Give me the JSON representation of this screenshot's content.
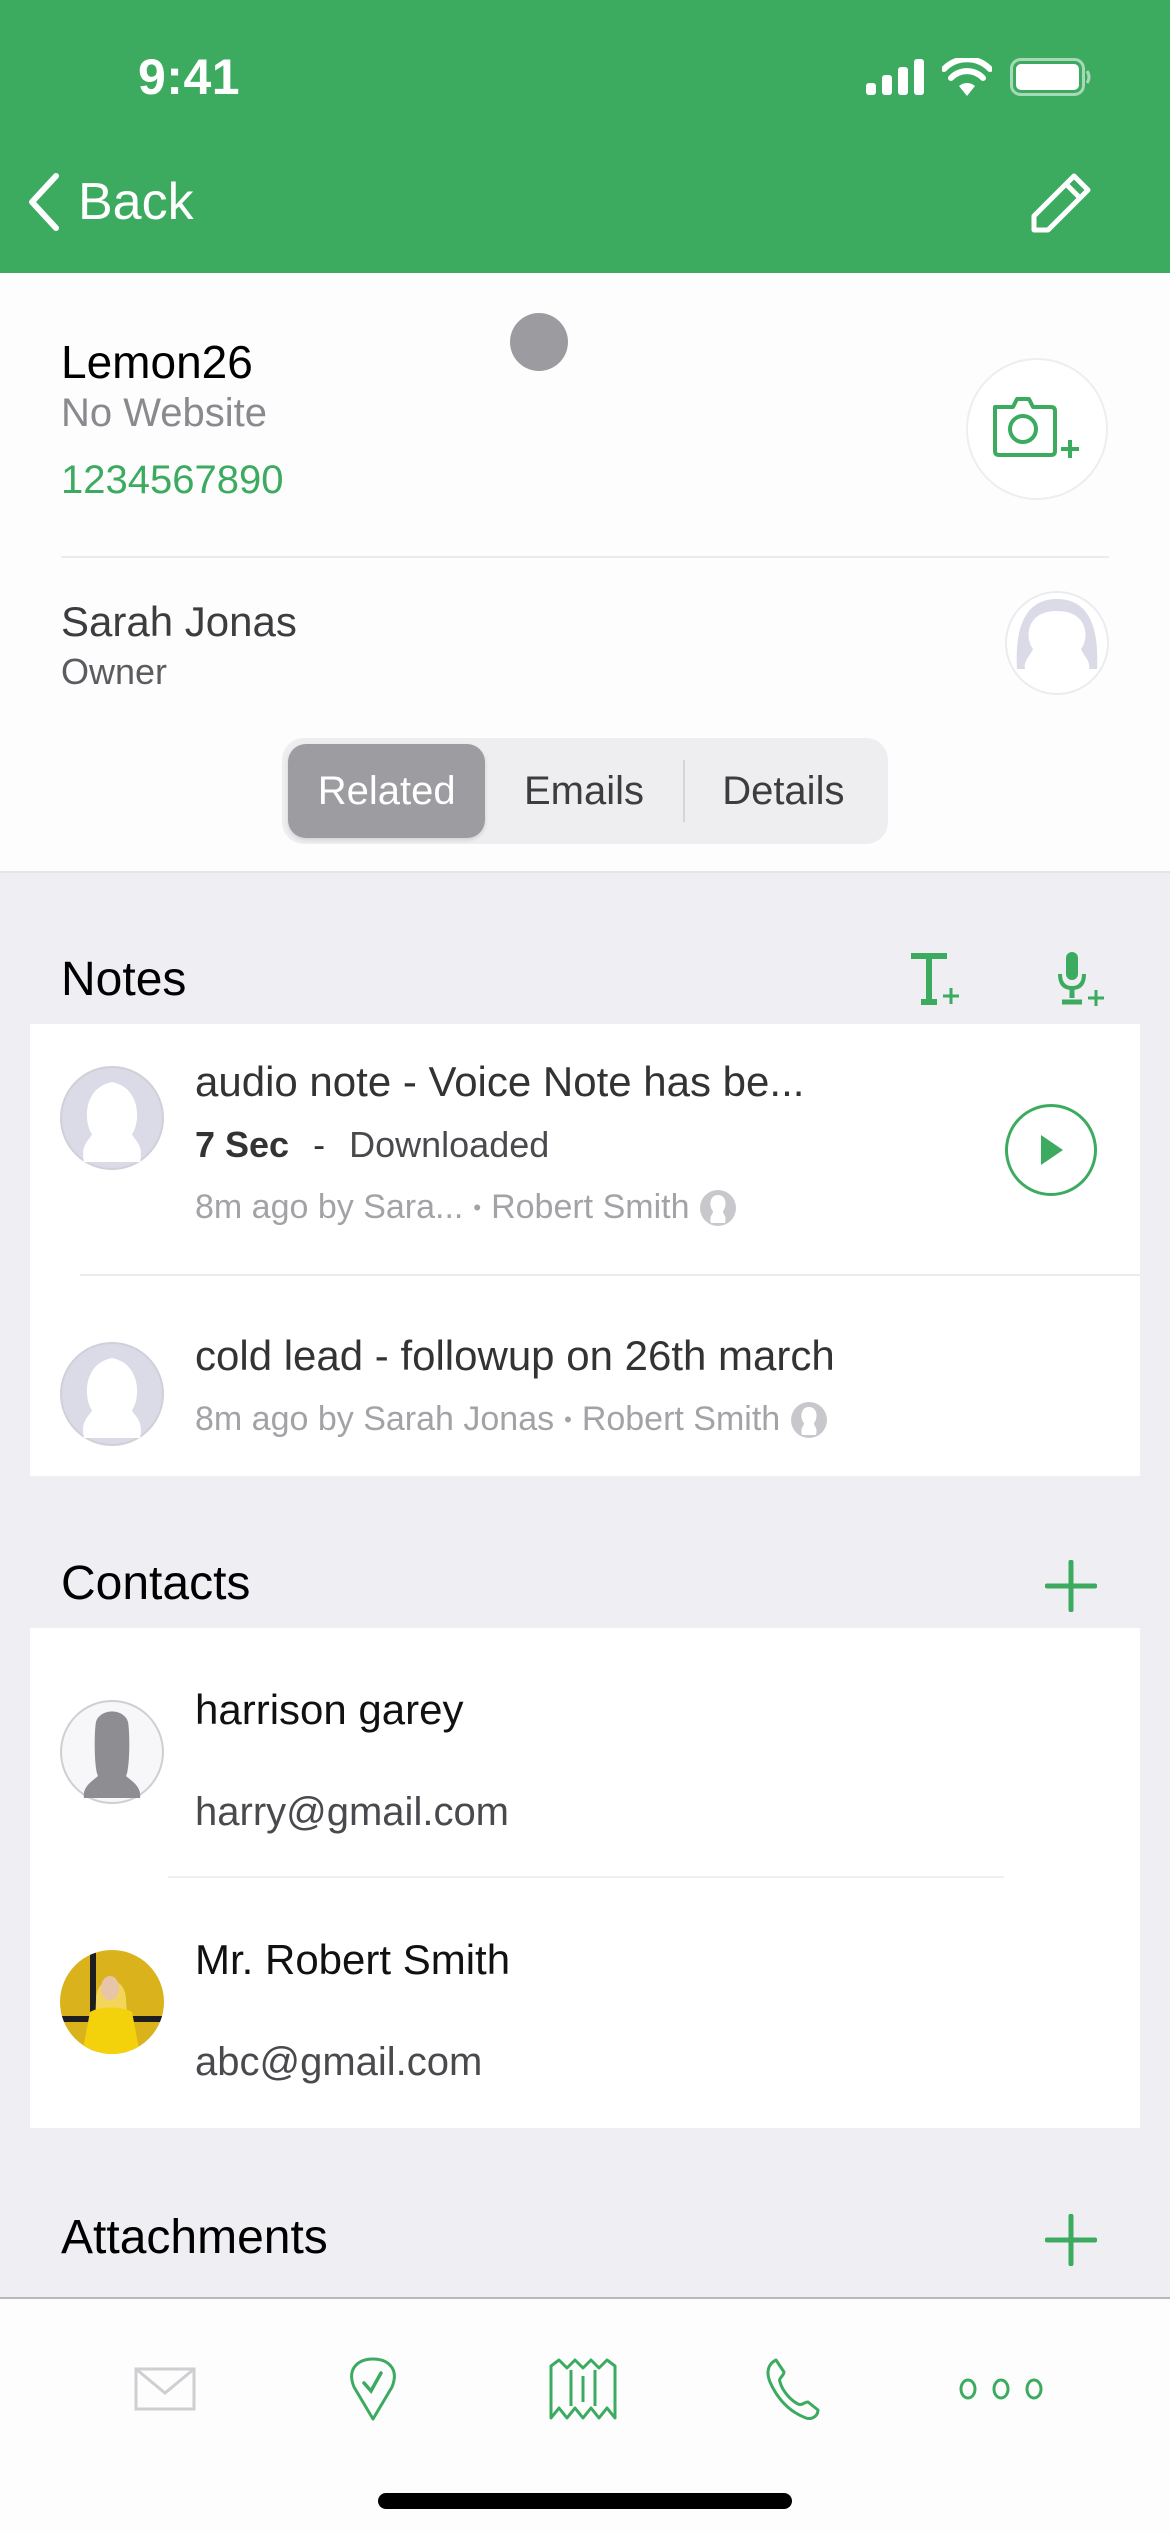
{
  "status_bar": {
    "time": "9:41"
  },
  "nav": {
    "back_label": "Back"
  },
  "colors": {
    "brand_green": "#3cab5f",
    "background": "#efeef3",
    "segment_active": "#9c9ca1"
  },
  "profile": {
    "company_name": "Lemon26",
    "website": "No Website",
    "phone": "1234567890",
    "owner_name": "Sarah Jonas",
    "owner_role": "Owner"
  },
  "segments": [
    {
      "label": "Related",
      "active": true
    },
    {
      "label": "Emails",
      "active": false
    },
    {
      "label": "Details",
      "active": false
    }
  ],
  "notes": {
    "title": "Notes",
    "items": [
      {
        "title": "audio note - Voice Note has be...",
        "duration": "7 Sec",
        "separator": "-",
        "status": "Downloaded",
        "meta_author": "8m ago by Sara...",
        "meta_contact": "Robert Smith",
        "type": "audio"
      },
      {
        "title": "cold lead - followup on 26th march",
        "meta_author": "8m ago by Sarah Jonas",
        "meta_contact": "Robert Smith",
        "type": "text"
      }
    ]
  },
  "contacts": {
    "title": "Contacts",
    "items": [
      {
        "name": "harrison garey",
        "email": "harry@gmail.com",
        "avatar": "placeholder"
      },
      {
        "name": "Mr. Robert Smith",
        "email": "abc@gmail.com",
        "avatar": "photo"
      }
    ]
  },
  "attachments": {
    "title": "Attachments"
  },
  "tabbar": {
    "items": [
      {
        "icon": "mail-icon",
        "enabled": false
      },
      {
        "icon": "checkin-pin-icon",
        "enabled": true
      },
      {
        "icon": "map-icon",
        "enabled": true
      },
      {
        "icon": "phone-icon",
        "enabled": true
      },
      {
        "icon": "more-icon",
        "enabled": true
      }
    ]
  }
}
